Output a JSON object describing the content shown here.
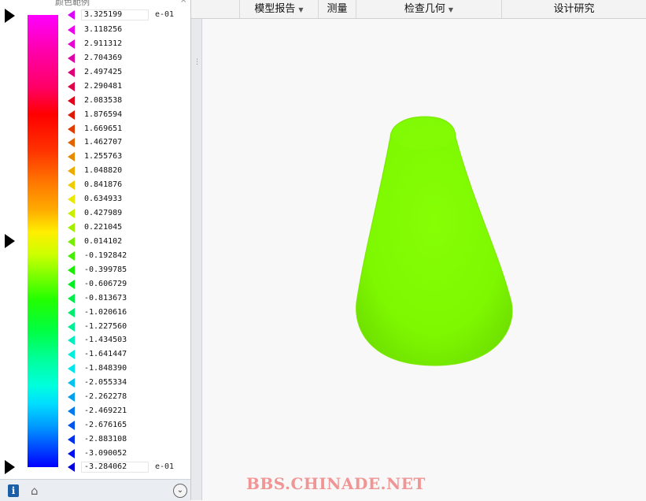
{
  "panel": {
    "title": "颜色範例",
    "close": "×",
    "max_value": "3.325199",
    "min_value": "-3.284062",
    "exponent_top": "e-01",
    "exponent_bottom": "e-01",
    "ticks": [
      {
        "label": "3.118256",
        "color": "#ee00ee"
      },
      {
        "label": "2.911312",
        "color": "#e600d6"
      },
      {
        "label": "2.704369",
        "color": "#e000a8"
      },
      {
        "label": "2.497425",
        "color": "#e0007a"
      },
      {
        "label": "2.290481",
        "color": "#e0004a"
      },
      {
        "label": "2.083538",
        "color": "#e0001c"
      },
      {
        "label": "1.876594",
        "color": "#e01800"
      },
      {
        "label": "1.669651",
        "color": "#e03c00"
      },
      {
        "label": "1.462707",
        "color": "#e06400"
      },
      {
        "label": "1.255763",
        "color": "#e68a00"
      },
      {
        "label": "1.048820",
        "color": "#eeaa00"
      },
      {
        "label": "0.841876",
        "color": "#eecc00"
      },
      {
        "label": "0.634933",
        "color": "#e8e800"
      },
      {
        "label": "0.427989",
        "color": "#c8ee00"
      },
      {
        "label": "0.221045",
        "color": "#a0ee00"
      },
      {
        "label": "0.014102",
        "color": "#77ee00"
      },
      {
        "label": "-0.192842",
        "color": "#44ee00"
      },
      {
        "label": "-0.399785",
        "color": "#1aee00"
      },
      {
        "label": "-0.606729",
        "color": "#00ee22"
      },
      {
        "label": "-0.813673",
        "color": "#00ee4a"
      },
      {
        "label": "-1.020616",
        "color": "#00ee70"
      },
      {
        "label": "-1.227560",
        "color": "#00ee96"
      },
      {
        "label": "-1.434503",
        "color": "#00eebb"
      },
      {
        "label": "-1.641447",
        "color": "#00eedd"
      },
      {
        "label": "-1.848390",
        "color": "#00e6ee"
      },
      {
        "label": "-2.055334",
        "color": "#00c4ee"
      },
      {
        "label": "-2.262278",
        "color": "#00a0ee"
      },
      {
        "label": "-2.469221",
        "color": "#007aee"
      },
      {
        "label": "-2.676165",
        "color": "#0055ee"
      },
      {
        "label": "-2.883108",
        "color": "#0030ee"
      },
      {
        "label": "-3.090052",
        "color": "#0010ee"
      }
    ],
    "top_color": "#dd00ff",
    "bottom_color": "#0000dd"
  },
  "toolbar": {
    "model_report": "模型报告",
    "measure": "测量",
    "inspect_geometry": "检查几何",
    "design_study": "设计研究"
  },
  "footer": {
    "info": "i",
    "home": "⌂",
    "expand": "⌄"
  },
  "splitter_grip": "⋮",
  "watermark": "BBS.CHINADE.NET",
  "model": {
    "color": "#7cff00"
  }
}
